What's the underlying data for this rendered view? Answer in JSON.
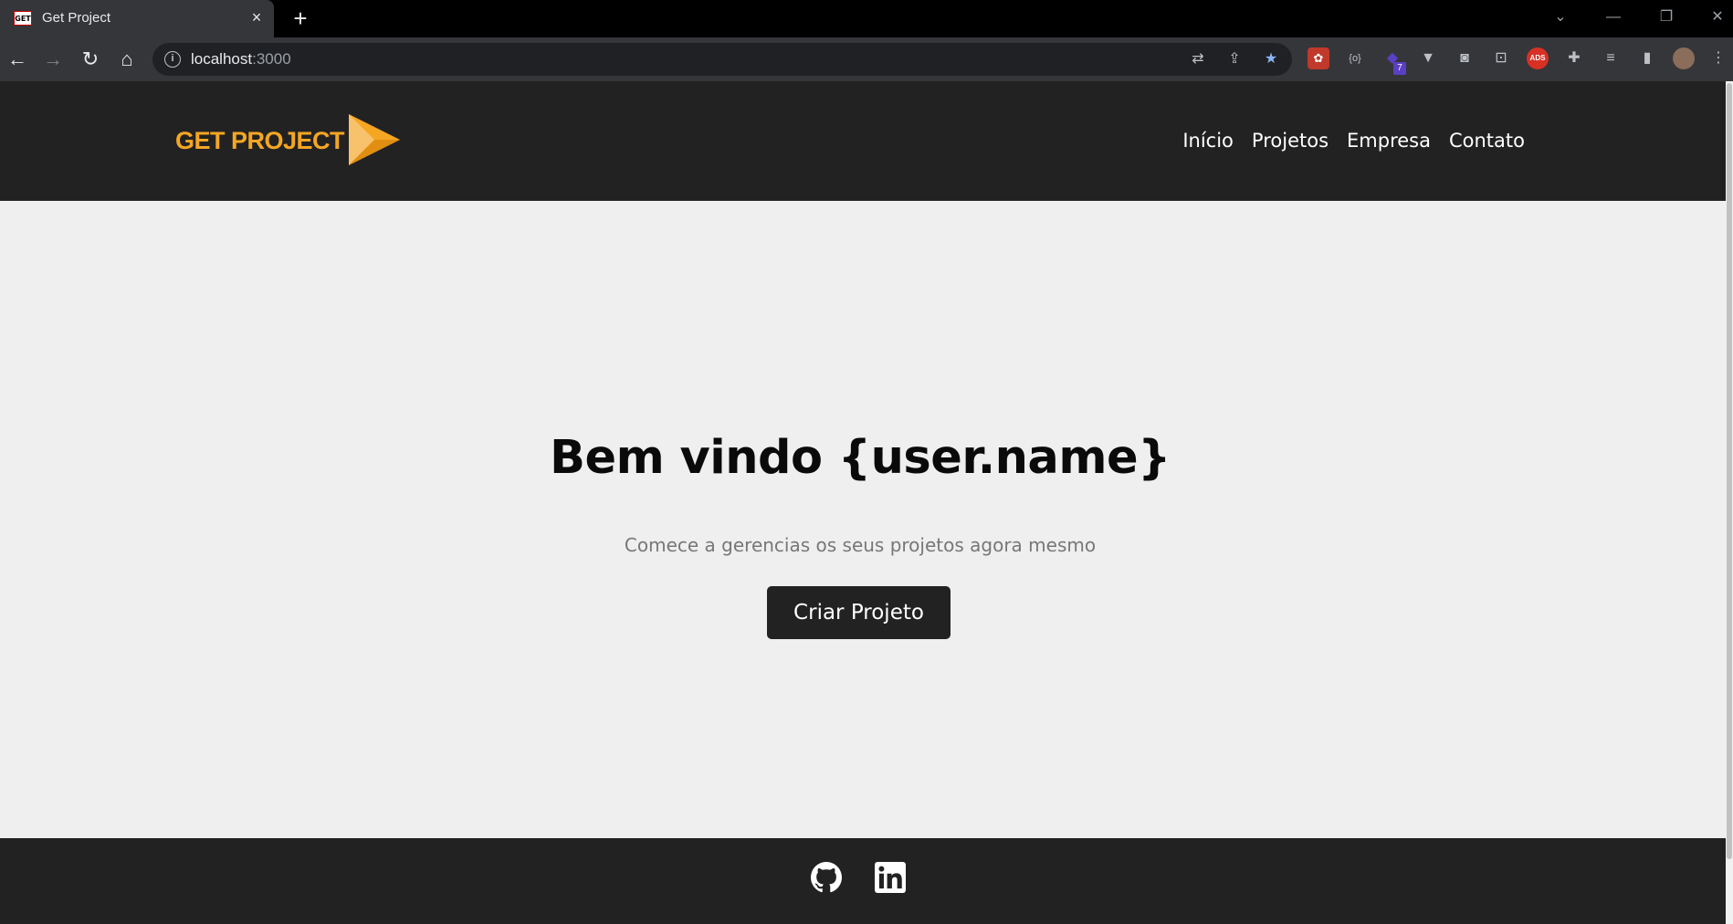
{
  "browser": {
    "tab_title": "Get Project",
    "favicon_text": "GET",
    "tab_close": "×",
    "new_tab": "+",
    "url_host": "localhost",
    "url_port": ":3000",
    "extension_badge": "7"
  },
  "site": {
    "logo_text": "GET PROJECT",
    "nav": {
      "inicio": "Início",
      "projetos": "Projetos",
      "empresa": "Empresa",
      "contato": "Contato"
    },
    "hero": {
      "title": "Bem vindo {user.name}",
      "subtitle": "Comece a gerencias os seus projetos agora mesmo",
      "cta": "Criar Projeto"
    },
    "footer": {
      "icons": [
        "github-icon",
        "linkedin-icon"
      ]
    }
  },
  "colors": {
    "header_bg": "#222222",
    "page_bg": "#efefef",
    "logo_orange": "#f5a623",
    "button_bg": "#222222"
  }
}
